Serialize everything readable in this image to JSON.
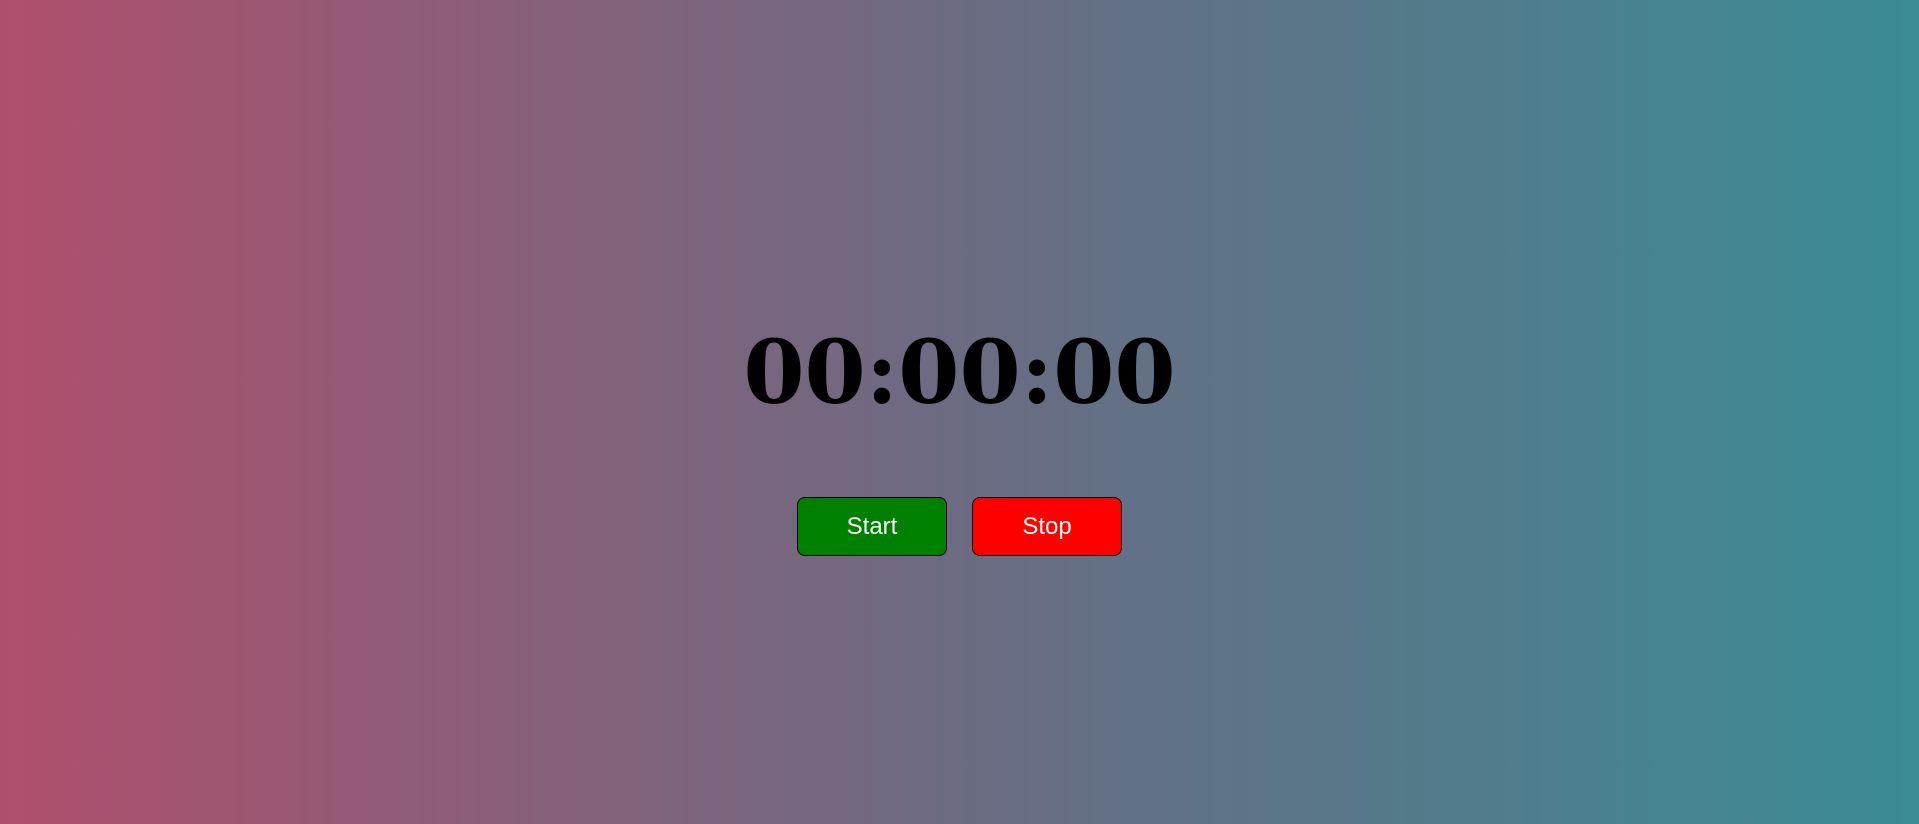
{
  "stopwatch": {
    "time": "00:00:00",
    "start_label": "Start",
    "stop_label": "Stop"
  },
  "colors": {
    "start_button": "#008000",
    "stop_button": "#ff0000",
    "gradient_left": "#af4f6d",
    "gradient_right": "#3a8c95"
  }
}
